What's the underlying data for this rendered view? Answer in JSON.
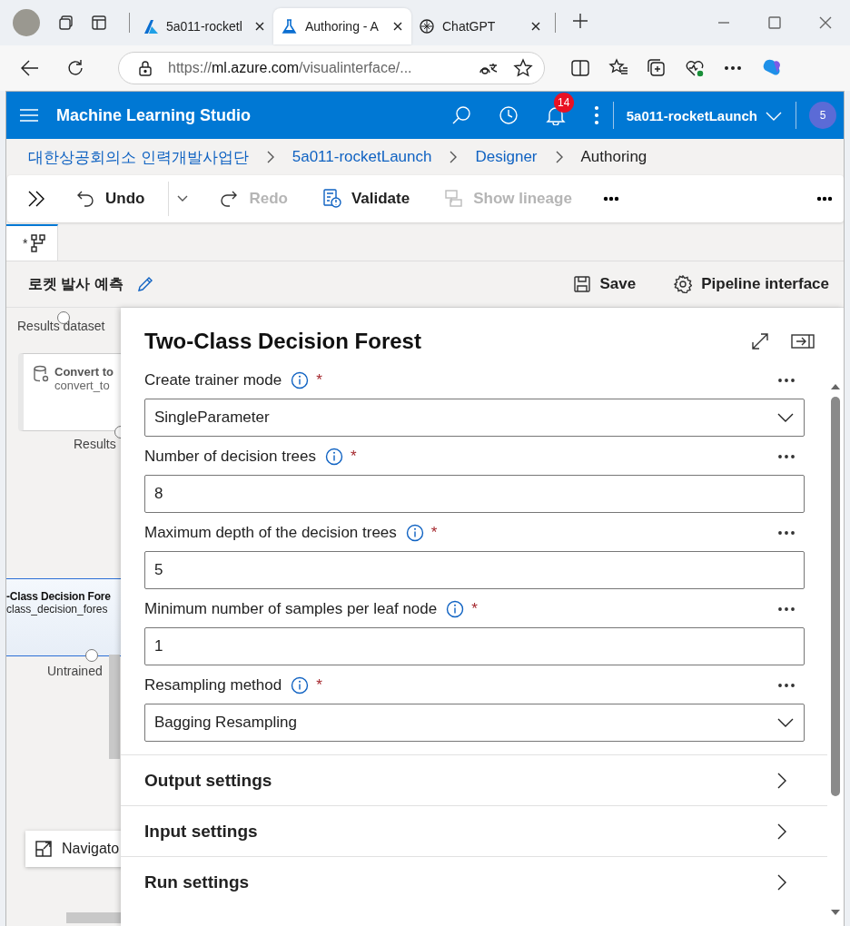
{
  "browser": {
    "tabs": [
      {
        "title": "5a011-rocketl",
        "selected": false
      },
      {
        "title": "Authoring - A",
        "selected": true
      },
      {
        "title": "ChatGPT",
        "selected": false
      }
    ],
    "address": {
      "scheme": "https://",
      "host": "ml.azure.com",
      "path": "/visualinterface/..."
    }
  },
  "app": {
    "title": "Machine Learning Studio",
    "notification_count": "14",
    "workspace": "5a011-rocketLaunch",
    "avatar": "5"
  },
  "breadcrumbs": [
    {
      "label": "대한상공회의소 인력개발사업단",
      "current": false
    },
    {
      "label": "5a011-rocketLaunch",
      "current": false
    },
    {
      "label": "Designer",
      "current": false
    },
    {
      "label": "Authoring",
      "current": true
    }
  ],
  "toolbar": [
    {
      "kind": "undo",
      "label": "Undo",
      "disabled": false
    },
    {
      "kind": "redo",
      "label": "Redo",
      "disabled": true
    },
    {
      "kind": "validate",
      "label": "Validate",
      "disabled": false
    },
    {
      "kind": "lineage",
      "label": "Show lineage",
      "disabled": true
    }
  ],
  "pipeline_tabs": [
    {
      "label": "*",
      "selected": true
    }
  ],
  "pipeline": {
    "name": "로켓 발사 예측",
    "actions": [
      {
        "kind": "save",
        "label": "Save"
      },
      {
        "kind": "settings",
        "label": "Pipeline interface"
      }
    ]
  },
  "canvas": {
    "port_labels": [
      {
        "label": "Results dataset"
      },
      {
        "label": "Results"
      },
      {
        "label": "Untrained"
      }
    ],
    "nodes": [
      {
        "title": "Convert to",
        "subtitle": "convert_to",
        "selected": false
      },
      {
        "title": "-Class Decision Fore",
        "subtitle": "class_decision_fores",
        "selected": true
      }
    ],
    "navigator": "Navigato"
  },
  "panel": {
    "title": "Two-Class Decision Forest",
    "parameters": [
      {
        "kind": "dropdown",
        "label": "Create trainer mode",
        "required_mark": "*",
        "value": "SingleParameter"
      },
      {
        "kind": "number",
        "label": "Number of decision trees",
        "required_mark": "*",
        "value": "8"
      },
      {
        "kind": "number",
        "label": "Maximum depth of the decision trees",
        "required_mark": "*",
        "value": "5"
      },
      {
        "kind": "number",
        "label": "Minimum number of samples per leaf node",
        "required_mark": "*",
        "value": "1"
      },
      {
        "kind": "dropdown",
        "label": "Resampling method",
        "required_mark": "*",
        "value": "Bagging Resampling"
      }
    ],
    "sections": [
      {
        "label": "Output settings",
        "expanded": false
      },
      {
        "label": "Input settings",
        "expanded": false
      },
      {
        "label": "Run settings",
        "expanded": false
      }
    ]
  }
}
